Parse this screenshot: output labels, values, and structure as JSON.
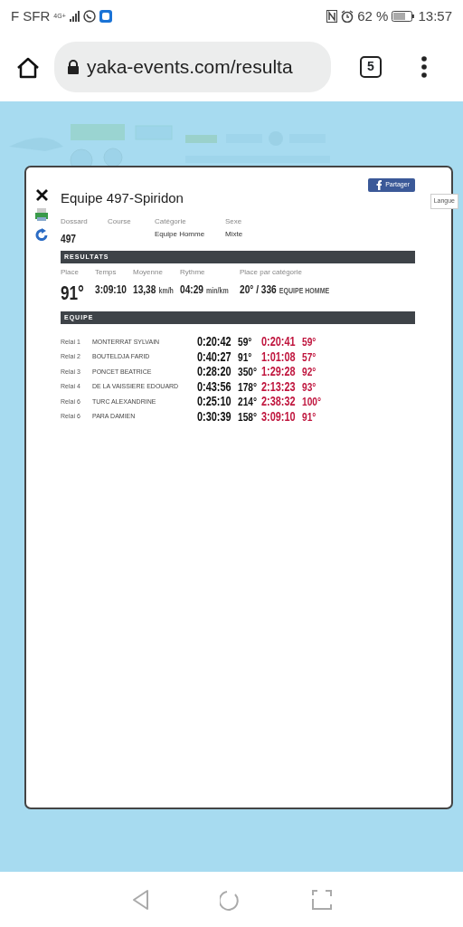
{
  "status_bar": {
    "carrier": "F SFR",
    "network": "4G+",
    "battery": "62 %",
    "time": "13:57"
  },
  "browser": {
    "url": "yaka-events.com/resulta",
    "tab_count": "5"
  },
  "modal": {
    "title": "Equipe 497-Spiridon",
    "share_button": "Partager",
    "tooltip": "Langue",
    "info": [
      {
        "label": "Dossard",
        "value": "497",
        "kind": "big"
      },
      {
        "label": "Course",
        "kind": "plain"
      },
      {
        "label": "Catégorie",
        "value": "Equipe Homme",
        "kind": "plain"
      },
      {
        "label": "Sexe",
        "value": "Mixte",
        "kind": "plain"
      }
    ],
    "results_heading": "RESULTATS",
    "results": [
      {
        "label": "Place",
        "value": "91°",
        "kind": "place"
      },
      {
        "label": "Temps",
        "value": "3:09:10",
        "kind": "stat"
      },
      {
        "label": "Moyenne",
        "value": "13,38",
        "unit": "km/h",
        "kind": "stat"
      },
      {
        "label": "Rythme",
        "value": "04:29",
        "unit": "min/km",
        "kind": "stat"
      },
      {
        "label": "Place par catégorie",
        "value": "20° / 336",
        "unit": "EQUIPE HOMME",
        "kind": "stat"
      }
    ],
    "team_heading": "EQUIPE",
    "relays": [
      {
        "relay": "Relai 1",
        "name": "MONTERRAT SYLVAIN",
        "time": "0:20:42",
        "rank": "59°",
        "cumulative_time": "0:20:41",
        "cumulative_rank": "59°"
      },
      {
        "relay": "Relai 2",
        "name": "BOUTELDJA FARID",
        "time": "0:40:27",
        "rank": "91°",
        "cumulative_time": "1:01:08",
        "cumulative_rank": "57°"
      },
      {
        "relay": "Relai 3",
        "name": "PONCET BEATRICE",
        "time": "0:28:20",
        "rank": "350°",
        "cumulative_time": "1:29:28",
        "cumulative_rank": "92°"
      },
      {
        "relay": "Relai 4",
        "name": "DE LA VAISSIERE EDOUARD",
        "time": "0:43:56",
        "rank": "178°",
        "cumulative_time": "2:13:23",
        "cumulative_rank": "93°"
      },
      {
        "relay": "Relai 6",
        "name": "TURC ALEXANDRINE",
        "time": "0:25:10",
        "rank": "214°",
        "cumulative_time": "2:38:32",
        "cumulative_rank": "100°"
      },
      {
        "relay": "Relai 6",
        "name": "PARA DAMIEN",
        "time": "0:30:39",
        "rank": "158°",
        "cumulative_time": "3:09:10",
        "cumulative_rank": "91°"
      }
    ]
  }
}
